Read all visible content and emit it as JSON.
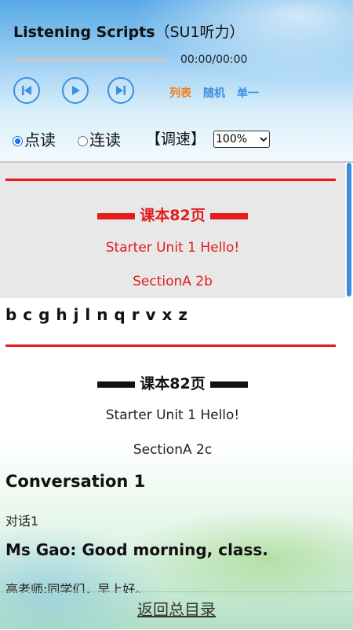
{
  "header": {
    "title_bold": "Listening Scripts",
    "title_sub": "（SU1听力）",
    "time": "00:00/00:00",
    "controls": {
      "prev_icon": "skip-previous-icon",
      "play_icon": "play-icon",
      "next_icon": "skip-next-icon"
    },
    "modes": [
      {
        "label": "列表",
        "color": "#f07d1a"
      },
      {
        "label": "随机",
        "color": "#3b8fe0"
      },
      {
        "label": "单一",
        "color": "#3b8fe0"
      }
    ],
    "read_modes": [
      {
        "label": "点读",
        "selected": true
      },
      {
        "label": "连读",
        "selected": false
      }
    ],
    "speed_label": "【调速】",
    "speed_value": "100%"
  },
  "content": {
    "section1": {
      "page_label": "课本82页",
      "unit": "Starter Unit 1 Hello!",
      "section": "SectionA 2b",
      "letters": "b c g h j l n q r v x z"
    },
    "section2": {
      "page_label": "课本82页",
      "unit": "Starter Unit 1 Hello!",
      "section": "SectionA 2c",
      "conversation_title": "Conversation 1",
      "conversation_cn": "对话1",
      "line1_en": "Ms Gao: Good morning, class.",
      "line1_cn": "高老师:同学们，早上好。"
    }
  },
  "footer": {
    "back_link": "返回总目录"
  },
  "colors": {
    "accent_blue": "#3b8fe0",
    "red": "#e31b1b",
    "orange": "#f07d1a"
  }
}
